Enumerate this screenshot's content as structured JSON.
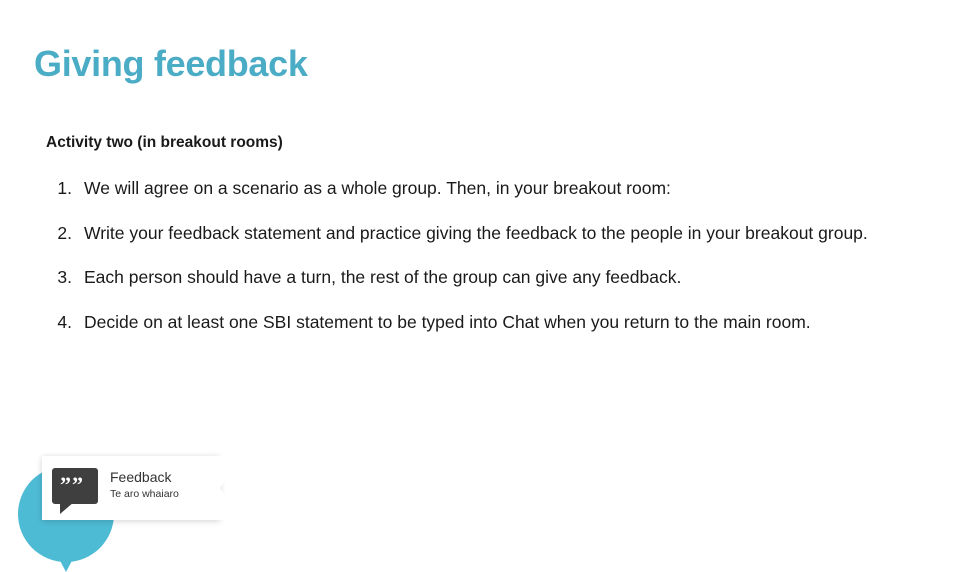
{
  "slide": {
    "title": "Giving feedback",
    "subhead": "Activity two (in breakout rooms)",
    "steps": [
      {
        "number": "1.",
        "text": "We will agree on a scenario as a whole group.  Then, in your breakout room:"
      },
      {
        "number": "2.",
        "text": "Write your feedback statement and practice giving the feedback to the people in your breakout group."
      },
      {
        "number": "3.",
        "text": "Each person should have a turn, the rest of the group can give any feedback."
      },
      {
        "number": "4.",
        "text": "Decide on at least one SBI statement to be typed into Chat when you return to the main room."
      }
    ],
    "logo": {
      "quote_glyph": "””",
      "line1": "Feedback",
      "line2": "Te aro whaiaro"
    },
    "colors": {
      "title_accent": "#4BACC6",
      "logo_teal": "#4EBBD5",
      "body_text": "#1a1a1a"
    }
  }
}
